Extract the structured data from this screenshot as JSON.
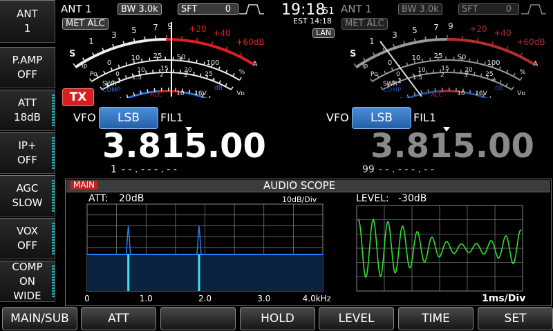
{
  "left_buttons": [
    {
      "name": "ant",
      "line1": "ANT",
      "line2": "1",
      "line3": ""
    },
    {
      "name": "pamp",
      "line1": "P.AMP",
      "line2": "OFF",
      "line3": ""
    },
    {
      "name": "att",
      "line1": "ATT",
      "line2": "18dB",
      "line3": ""
    },
    {
      "name": "ipplus",
      "line1": "IP+",
      "line2": "OFF",
      "line3": ""
    },
    {
      "name": "agc",
      "line1": "AGC",
      "line2": "SLOW",
      "line3": ""
    },
    {
      "name": "vox",
      "line1": "VOX",
      "line2": "OFF",
      "line3": ""
    },
    {
      "name": "comp",
      "line1": "COMP",
      "line2": "ON",
      "line3": "WIDE"
    }
  ],
  "clock": {
    "time": "19:18",
    "seconds": "51",
    "zone": "EST 14:18",
    "lan": "LAN"
  },
  "main": {
    "ant": "ANT 1",
    "bw_label": "BW",
    "bw_value": "3.0k",
    "sft_label": "SFT",
    "sft_value": "0",
    "met": "MET",
    "alc": "ALC",
    "tx": "TX",
    "vfo": "VFO",
    "mode": "LSB",
    "fil": "FIL1",
    "freq_a": "3.815",
    "freq_b": ".00",
    "memory_ch": "1",
    "memory_name": "- - . - - - . - -"
  },
  "sub": {
    "ant": "ANT 1",
    "bw_label": "BW",
    "bw_value": "3.0k",
    "sft_label": "SFT",
    "sft_value": "0",
    "met": "MET",
    "alc": "ALC",
    "vfo": "VFO",
    "mode": "LSB",
    "fil": "FIL1",
    "freq_a": "3.815",
    "freq_b": ".00",
    "memory_ch": "99",
    "memory_name": "- - . - - - . - -"
  },
  "meter_scale": {
    "s": "S",
    "s_marks": [
      "1",
      "3",
      "5",
      "7",
      "9"
    ],
    "plus_marks": [
      "+20",
      "+40",
      "+60dB"
    ],
    "ip": "Ip",
    "po": "Po",
    "po_marks": [
      "0",
      "10",
      "25",
      "50",
      "100"
    ],
    "ip_marks": [
      "0",
      "10",
      "15",
      "20",
      "25"
    ],
    "a": "A",
    "pct": "%",
    "swr": "SWR",
    "comp": "COMP",
    "swr_marks": [
      "1",
      "1.5",
      "2",
      "3",
      "∞"
    ],
    "alc": "ALC",
    "db": "dB",
    "vd": "Vᴅ",
    "vd_marks": [
      "10",
      "16V"
    ],
    "comp_marks": [
      "0",
      "10",
      "20"
    ]
  },
  "scope": {
    "main_tag": "MAIN",
    "title": "AUDIO SCOPE",
    "att_label": "ATT:",
    "att_value": "20dB",
    "div": "10dB/Div",
    "level_label": "LEVEL:",
    "level_value": "-30dB",
    "time_div": "1ms/Div",
    "x_ticks": [
      "0",
      "1.0",
      "2.0",
      "3.0",
      "4.0kHz"
    ],
    "signal_peaks_khz": [
      0.7,
      1.9
    ],
    "colors": {
      "grid": "#888888",
      "trace": "#2080ff",
      "peak": "#38e8f0",
      "wave": "#30e030"
    }
  },
  "bottom_buttons": [
    "MAIN/SUB",
    "ATT",
    "",
    "HOLD",
    "LEVEL",
    "TIME",
    "SET"
  ]
}
